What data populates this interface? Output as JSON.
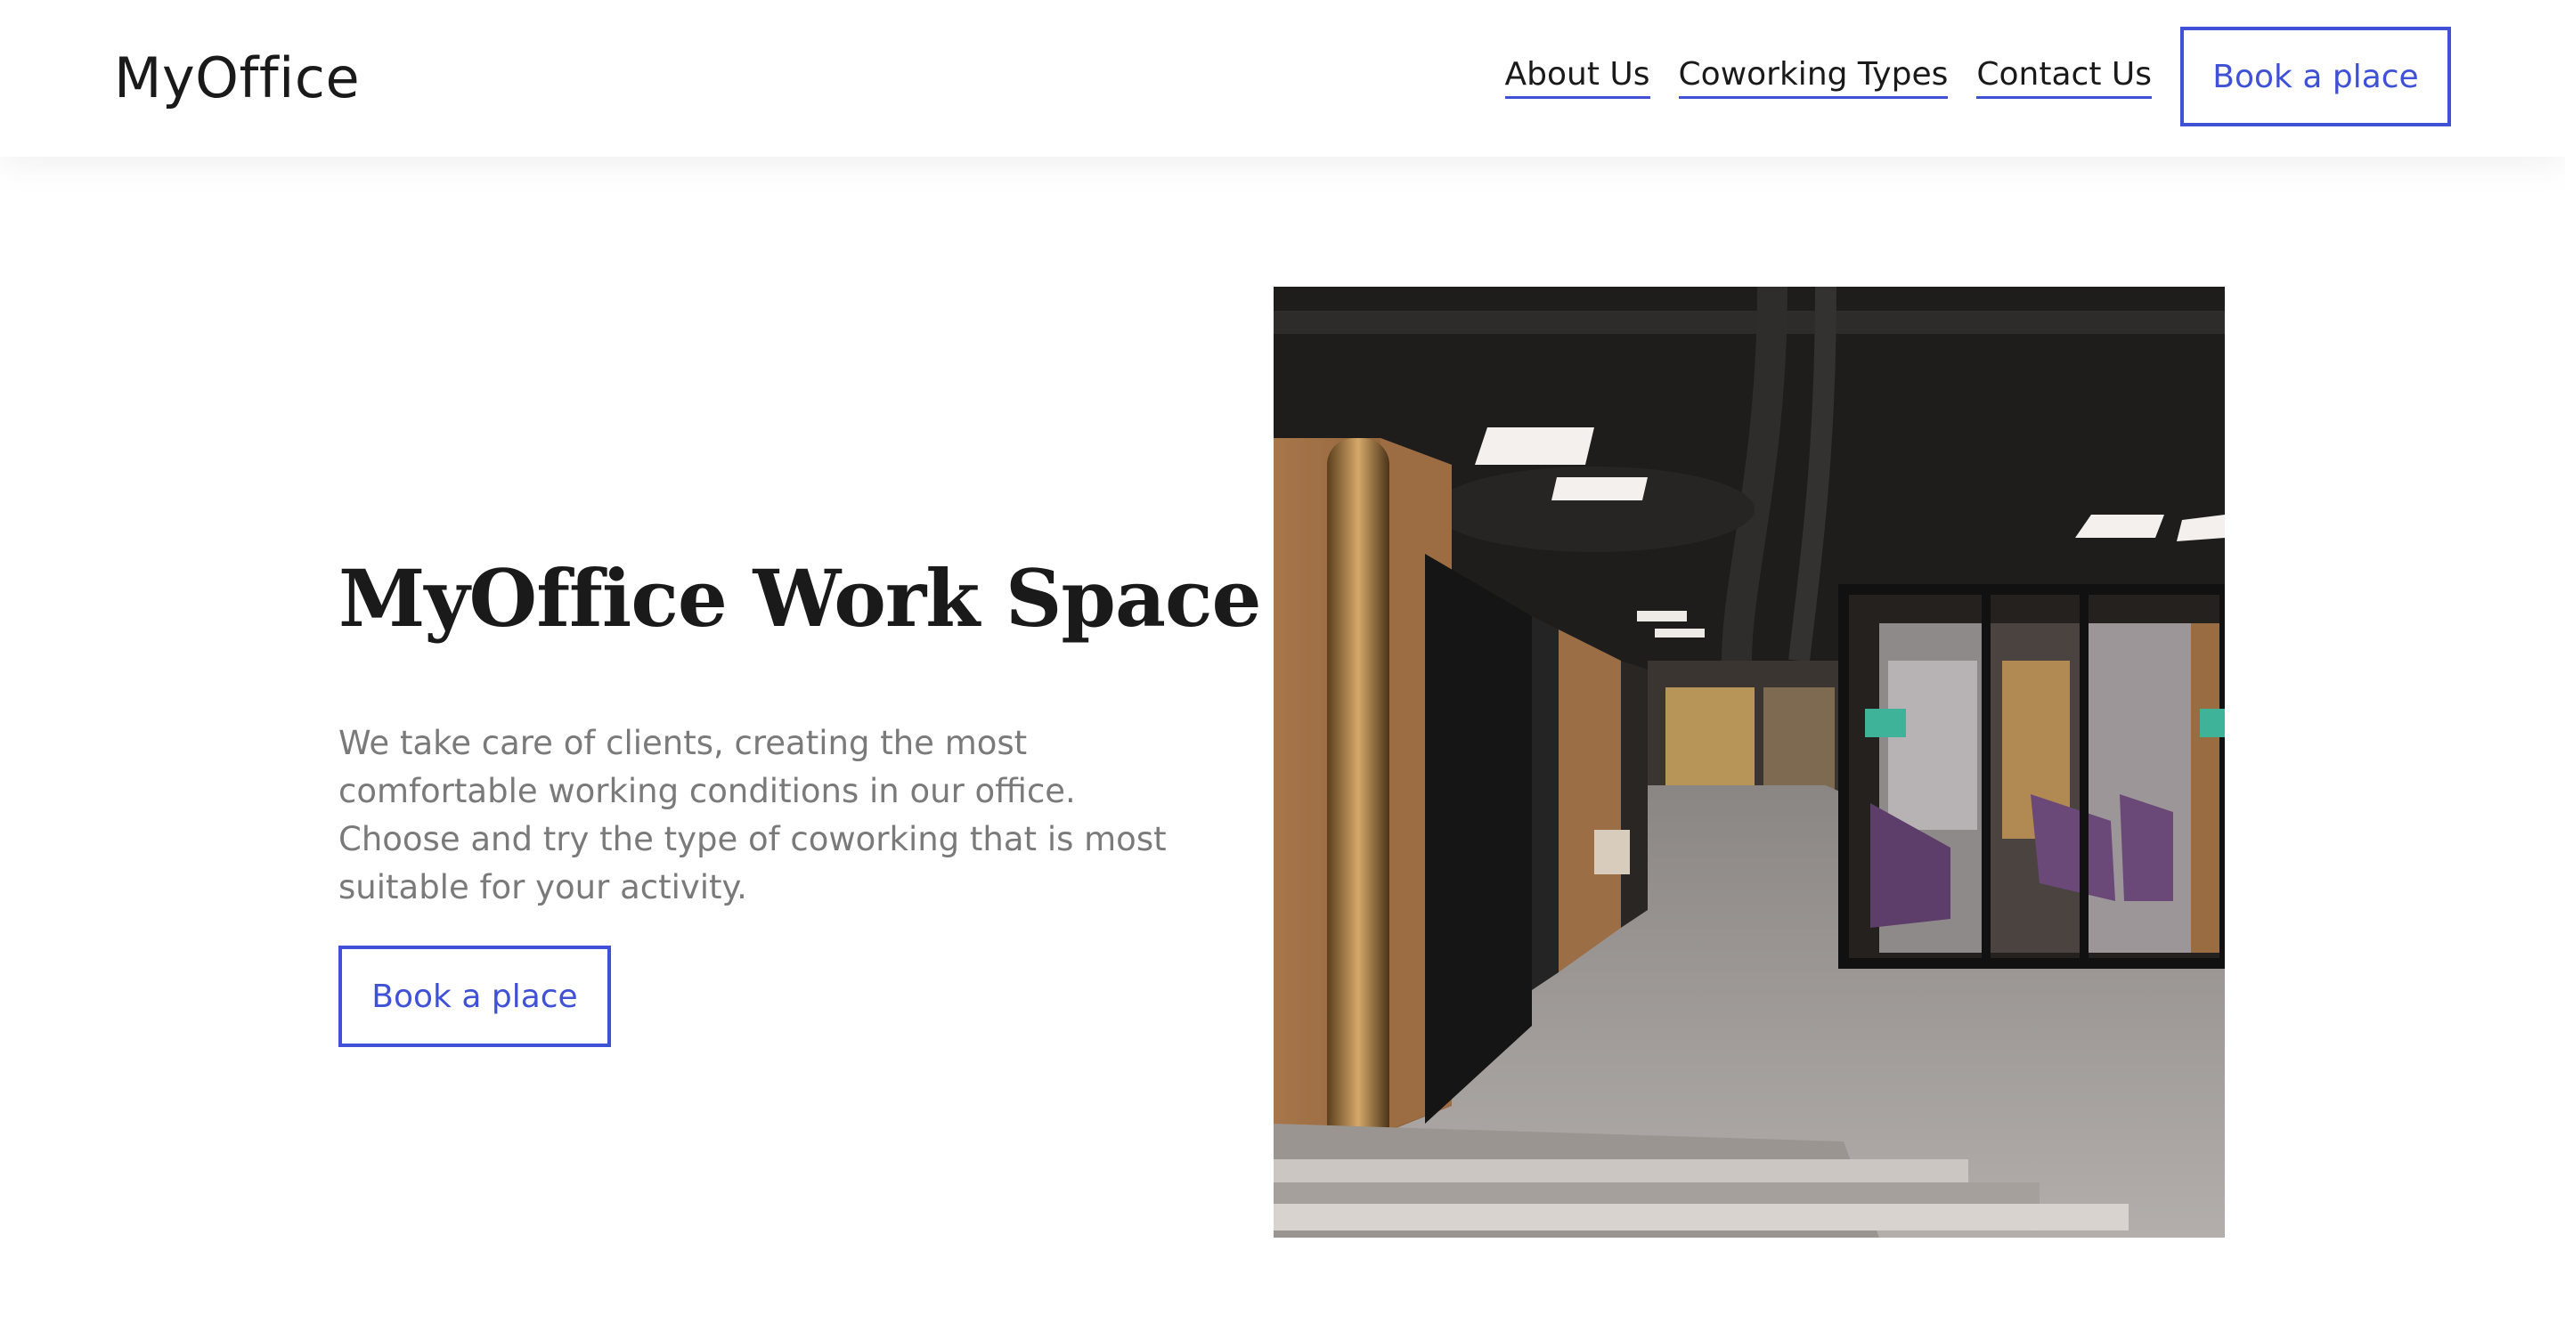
{
  "header": {
    "logo": "MyOffice",
    "nav": [
      {
        "label": "About Us"
      },
      {
        "label": "Coworking Types"
      },
      {
        "label": "Contact Us"
      }
    ],
    "cta_label": "Book a place"
  },
  "hero": {
    "title": "MyOffice Work Space",
    "description": "We take care of clients, creating the most comfortable working conditions in our office. Choose and try the type of coworking that is most suitable for your activity.",
    "cta_label": "Book a place"
  },
  "colors": {
    "accent": "#3f51d6",
    "text": "#1a1a1a",
    "muted": "#7a7a7a"
  }
}
